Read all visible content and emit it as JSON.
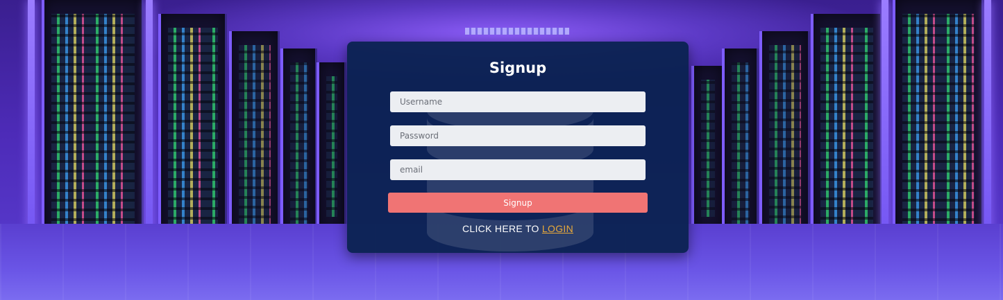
{
  "form": {
    "title": "Signup",
    "username_placeholder": "Username",
    "password_placeholder": "Password",
    "email_placeholder": "email",
    "submit_label": "Signup",
    "login_prompt": "CLICK HERE TO ",
    "login_link": "LOGIN"
  },
  "colors": {
    "card_background": "#0a2250",
    "button": "#f07474",
    "link": "#e9a93a",
    "input_background": "#eceef2"
  },
  "icons": {
    "card_watermark": "database-icon"
  }
}
